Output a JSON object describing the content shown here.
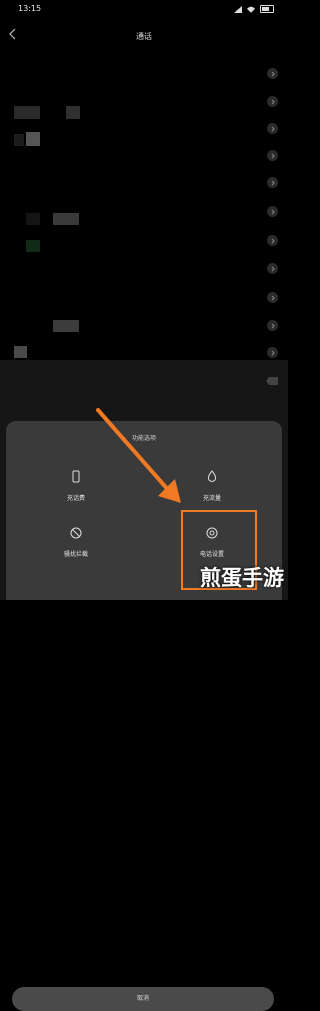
{
  "status": {
    "time": "13:15"
  },
  "header": {
    "title": "通话"
  },
  "sheet": {
    "title": "功能选项",
    "options": [
      {
        "label": "充话费",
        "icon": "phone-icon"
      },
      {
        "label": "充流量",
        "icon": "drop-icon"
      },
      {
        "label": "骚扰拦截",
        "icon": "block-icon"
      },
      {
        "label": "电话设置",
        "icon": "gear-icon"
      }
    ],
    "cancel": "取消"
  },
  "watermark": "煎蛋手游",
  "colors": {
    "highlight": "#f07a23",
    "sheet": "#3a3a3a"
  }
}
